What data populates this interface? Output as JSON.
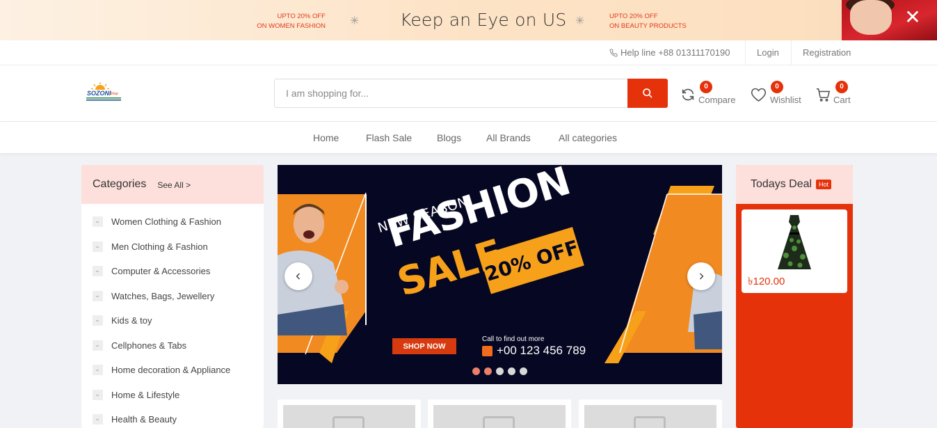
{
  "promo": {
    "left_line1": "UPTO 20% OFF",
    "left_line2": "ON WOMEN FASHION",
    "title": "Keep an Eye on US",
    "right_line1": "UPTO 20% OFF",
    "right_line2": "ON BEAUTY PRODUCTS",
    "star": "✳",
    "close": "✕"
  },
  "topbar": {
    "helpline": "Help line +88 01311170190",
    "login": "Login",
    "registration": "Registration"
  },
  "header": {
    "logo_text": "SOZONI",
    "logo_sub": "Shop",
    "search_placeholder": "I am shopping for...",
    "compare": {
      "label": "Compare",
      "count": "0"
    },
    "wishlist": {
      "label": "Wishlist",
      "count": "0"
    },
    "cart": {
      "label": "Cart",
      "count": "0"
    },
    "accent_color": "#e5320a"
  },
  "nav": {
    "items": [
      "Home",
      "Flash Sale",
      "Blogs",
      "All Brands",
      "All categories"
    ]
  },
  "categories": {
    "title": "Categories",
    "see_all": "See All >",
    "items": [
      "Women Clothing & Fashion",
      "Men Clothing & Fashion",
      "Computer & Accessories",
      "Watches, Bags, Jewellery",
      "Kids & toy",
      "Cellphones & Tabs",
      "Home decoration & Appliance",
      "Home & Lifestyle",
      "Health & Beauty"
    ]
  },
  "hero": {
    "season": "NEW SEASON",
    "fashion": "FASHION",
    "sale": "SALE",
    "off": "20% OFF",
    "shop_now": "SHOP NOW",
    "call_label": "Call to find out more",
    "phone": "+00 123 456 789",
    "slide_count": 5,
    "active_slide": 2
  },
  "deal": {
    "title": "Todays Deal",
    "badge": "Hot",
    "price": "৳120.00"
  }
}
